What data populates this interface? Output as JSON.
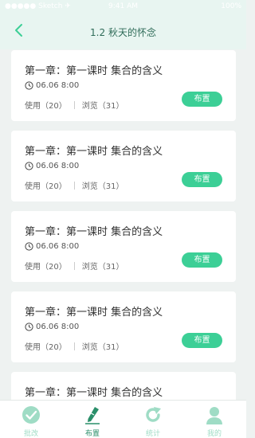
{
  "status_bar": {
    "carrier": "●●●●● Sketch ✈",
    "time": "9:41 AM",
    "battery": "100%"
  },
  "header": {
    "title": "1.2 秋天的怀念"
  },
  "cards": [
    {
      "title": "第一章：第一课时 集合的含义",
      "date": "06.06 8:00",
      "used": "使用（20）",
      "views": "浏览（31）",
      "button": "布置"
    },
    {
      "title": "第一章：第一课时 集合的含义",
      "date": "06.06 8:00",
      "used": "使用（20）",
      "views": "浏览（31）",
      "button": "布置"
    },
    {
      "title": "第一章：第一课时 集合的含义",
      "date": "06.06 8:00",
      "used": "使用（20）",
      "views": "浏览（31）",
      "button": "布置"
    },
    {
      "title": "第一章：第一课时 集合的含义",
      "date": "06.06 8:00",
      "used": "使用（20）",
      "views": "浏览（31）",
      "button": "布置"
    },
    {
      "title": "第一章：第一课时 集合的含义"
    }
  ],
  "tabbar": {
    "items": [
      {
        "label": "批改",
        "icon": "check-circle-icon"
      },
      {
        "label": "布置",
        "icon": "pen-icon",
        "active": true
      },
      {
        "label": "统计",
        "icon": "refresh-arrow-icon"
      },
      {
        "label": "我的",
        "icon": "person-icon"
      }
    ]
  },
  "colors": {
    "accent": "#3ccf96",
    "accent_dark": "#2a8f6a",
    "accent_light": "#9fdcc5",
    "header_bg": "#e8f5f1",
    "page_bg": "#eef2f1"
  }
}
